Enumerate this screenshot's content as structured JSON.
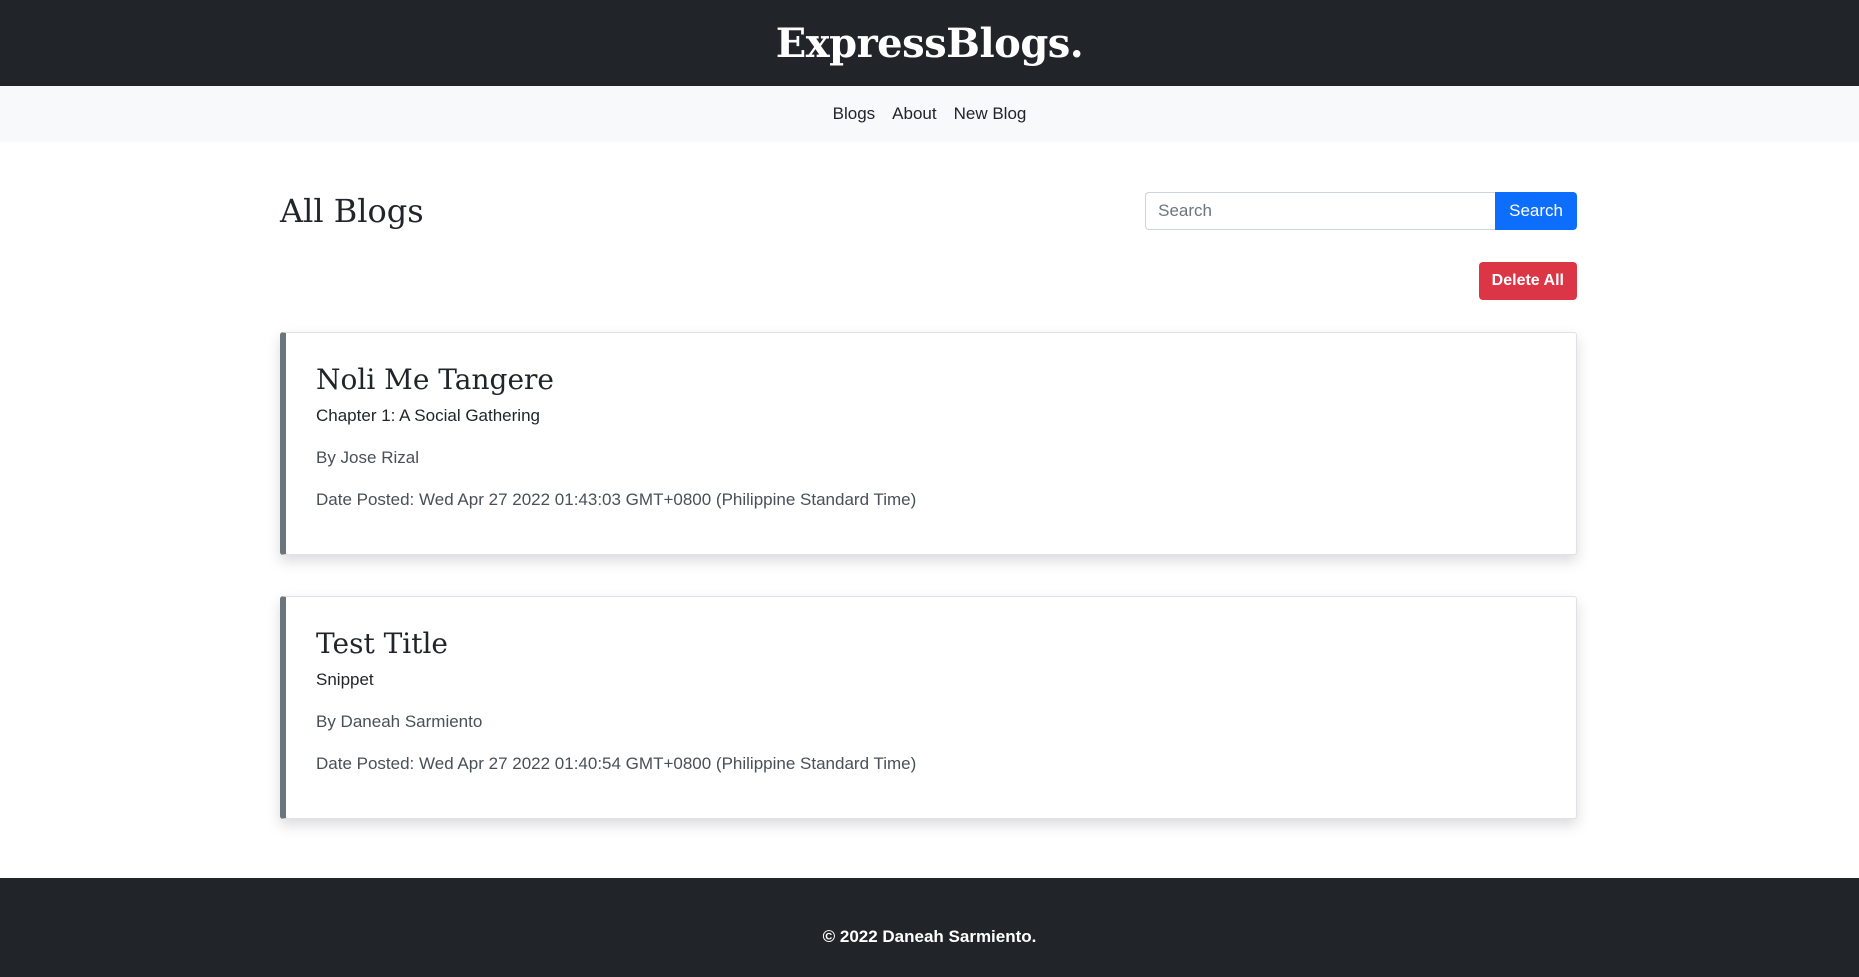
{
  "header": {
    "brand": "ExpressBlogs."
  },
  "nav": {
    "items": [
      "Blogs",
      "About",
      "New Blog"
    ]
  },
  "main": {
    "title": "All Blogs",
    "search": {
      "placeholder": "Search",
      "value": "",
      "button_label": "Search"
    },
    "delete_all_label": "Delete All"
  },
  "blogs": [
    {
      "title": "Noli Me Tangere",
      "snippet": "Chapter 1: A Social Gathering",
      "author": "By Jose Rizal",
      "date": "Date Posted: Wed Apr 27 2022 01:43:03 GMT+0800 (Philippine Standard Time)"
    },
    {
      "title": "Test Title",
      "snippet": "Snippet",
      "author": "By Daneah Sarmiento",
      "date": "Date Posted: Wed Apr 27 2022 01:40:54 GMT+0800 (Philippine Standard Time)"
    }
  ],
  "footer": {
    "copyright": "© 2022 Daneah Sarmiento."
  },
  "colors": {
    "dark": "#212529",
    "nav_bg": "#f8f9fa",
    "primary": "#0d6efd",
    "danger": "#dc3545",
    "card_accent": "#6c757d"
  }
}
